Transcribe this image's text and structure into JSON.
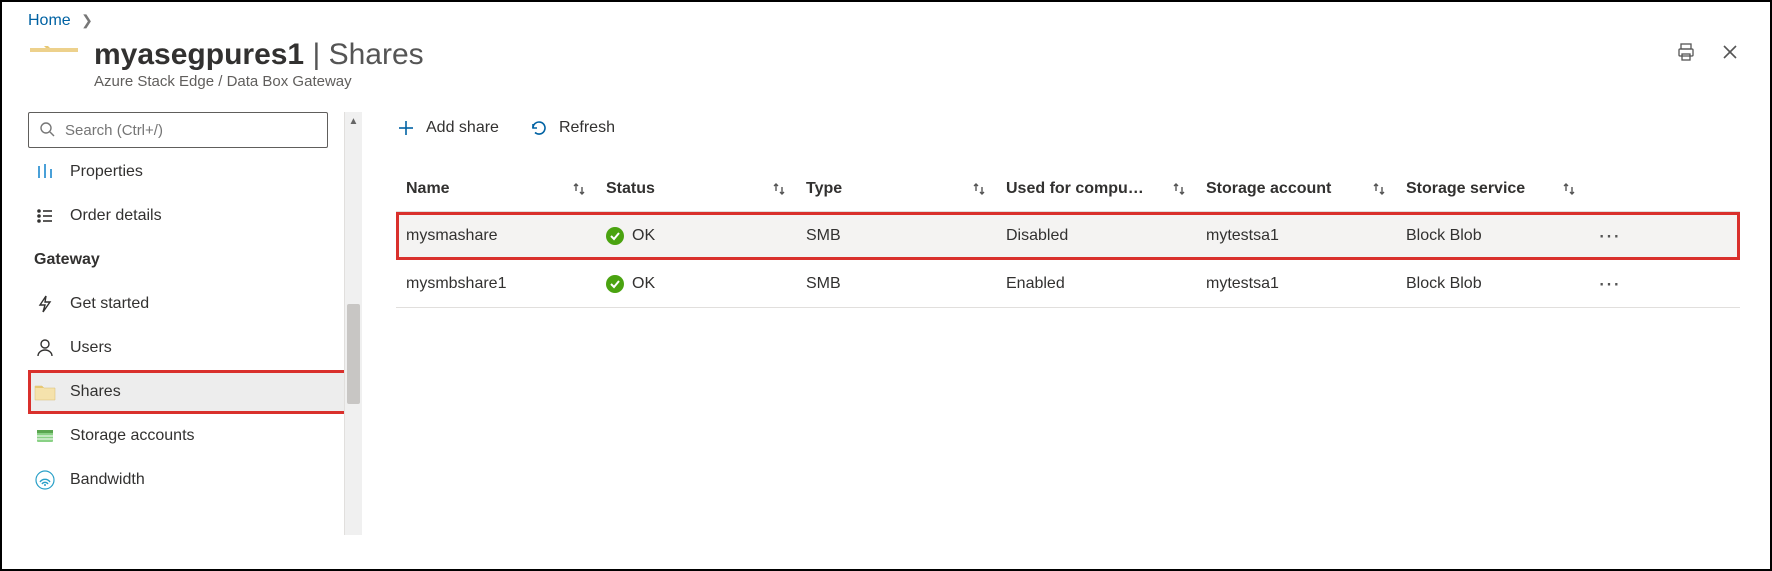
{
  "breadcrumb": {
    "home": "Home"
  },
  "header": {
    "resource_name": "myasegpures1",
    "section": "Shares",
    "subtitle": "Azure Stack Edge / Data Box Gateway"
  },
  "search": {
    "placeholder": "Search (Ctrl+/)"
  },
  "sidebar": {
    "items": [
      {
        "label": "Properties"
      },
      {
        "label": "Order details"
      }
    ],
    "group": "Gateway",
    "gateway_items": [
      {
        "label": "Get started"
      },
      {
        "label": "Users"
      },
      {
        "label": "Shares",
        "selected": true
      },
      {
        "label": "Storage accounts"
      },
      {
        "label": "Bandwidth"
      }
    ]
  },
  "toolbar": {
    "add_share": "Add share",
    "refresh": "Refresh"
  },
  "table": {
    "columns": {
      "name": "Name",
      "status": "Status",
      "type": "Type",
      "compute": "Used for compu…",
      "account": "Storage account",
      "service": "Storage service"
    },
    "rows": [
      {
        "name": "mysmashare",
        "status": "OK",
        "type": "SMB",
        "compute": "Disabled",
        "account": "mytestsa1",
        "service": "Block Blob",
        "highlight": true
      },
      {
        "name": "mysmbshare1",
        "status": "OK",
        "type": "SMB",
        "compute": "Enabled",
        "account": "mytestsa1",
        "service": "Block Blob",
        "highlight": false
      }
    ]
  }
}
